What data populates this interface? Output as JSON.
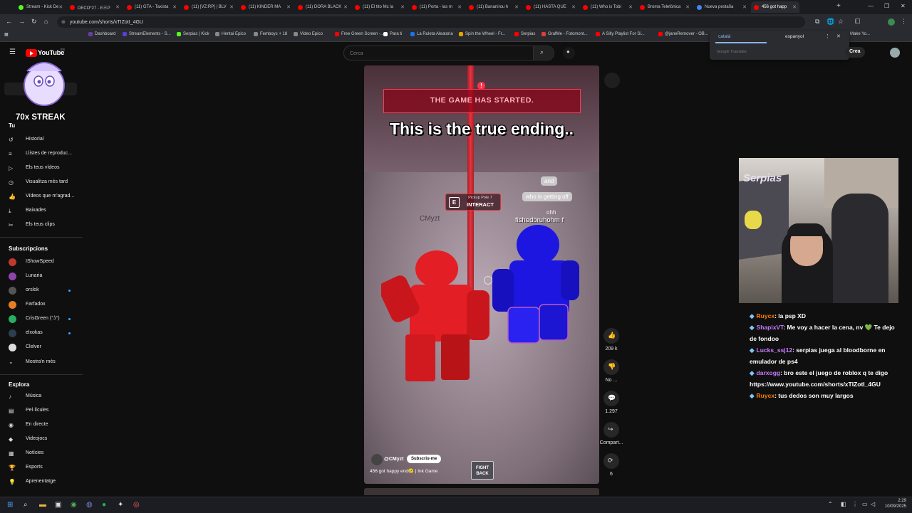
{
  "browser": {
    "tabs": [
      {
        "label": "Stream - Kick De",
        "color": "#53fc18"
      },
      {
        "label": "DECO*27 - E三P",
        "color": "#ff0000"
      },
      {
        "label": "(11) GTA - Taxista",
        "color": "#ff0000"
      },
      {
        "label": "(11) [VZ:RP] | BLV",
        "color": "#ff0000"
      },
      {
        "label": "(11) KINDER MA",
        "color": "#ff0000"
      },
      {
        "label": "(11) DORA BLACK",
        "color": "#ff0000"
      },
      {
        "label": "(11) El tito Mc la",
        "color": "#ff0000"
      },
      {
        "label": "(11) Porta - las m",
        "color": "#ff0000"
      },
      {
        "label": "(11) Bananirou h",
        "color": "#ff0000"
      },
      {
        "label": "(11) HASTA QUE",
        "color": "#ff0000"
      },
      {
        "label": "(11) Who is Tobi",
        "color": "#ff0000"
      },
      {
        "label": "Broma Telefónica",
        "color": "#ff0000"
      },
      {
        "label": "Nueva pestaña",
        "color": "#4285f4"
      },
      {
        "label": "456 got happ",
        "color": "#ff0000"
      }
    ],
    "url": "youtube.com/shorts/xTIZotI_4GU",
    "bookmarks": [
      {
        "label": "Dashboard",
        "color": "#6441a5"
      },
      {
        "label": "StreamElements - S...",
        "color": "#5a3fd6"
      },
      {
        "label": "Serpias | Kick",
        "color": "#53fc18"
      },
      {
        "label": "Hentai Epico",
        "color": "#888888"
      },
      {
        "label": "Femboys + 18",
        "color": "#888888"
      },
      {
        "label": "Video Epico",
        "color": "#888888"
      },
      {
        "label": "Free Green Screen -...",
        "color": "#ff0000"
      },
      {
        "label": "Para ti",
        "color": "#ffffff"
      },
      {
        "label": "La Ruleta Aleatoria",
        "color": "#1a73e8"
      },
      {
        "label": "Spin the Wheel - Fr...",
        "color": "#e6a400"
      },
      {
        "label": "Serpias",
        "color": "#ff0000"
      },
      {
        "label": "GrafMe - Fotomont...",
        "color": "#e33b3b"
      },
      {
        "label": "A Silly Playlist For Si...",
        "color": "#ff0000"
      },
      {
        "label": "@janeRemover - OB...",
        "color": "#ff0000"
      },
      {
        "label": "Make Yo...",
        "color": "#888888"
      }
    ],
    "translate": {
      "lang_from": "català",
      "lang_to": "espanyol",
      "label": "Google Translate"
    }
  },
  "youtube": {
    "logo": "YouTube",
    "logo_sup": "ES",
    "search_placeholder": "Cerca",
    "create_label": "Crea",
    "streak_text": "70x STREAK",
    "you_label": "Tu",
    "you_items": [
      "Historial",
      "Llistes de reproduc...",
      "Els teus vídeos",
      "Visualitza més tard",
      "Vídeos que m'agrad...",
      "Baixades",
      "Els teus clips"
    ],
    "subs_heading": "Subscripcions",
    "subscriptions": [
      {
        "name": "IShowSpeed",
        "color": "#c0392b",
        "dot": false
      },
      {
        "name": "Lunaria",
        "color": "#8e44ad",
        "dot": false
      },
      {
        "name": "orslok",
        "color": "#555555",
        "dot": true
      },
      {
        "name": "Farfadox",
        "color": "#e67e22",
        "dot": false
      },
      {
        "name": "CrisGreen (°ʖ°)",
        "color": "#27ae60",
        "dot": true
      },
      {
        "name": "elxokas",
        "color": "#2c3e50",
        "dot": true
      },
      {
        "name": "Clelver",
        "color": "#dddddd",
        "dot": false
      }
    ],
    "show_more": "Mostra'n més",
    "explore_heading": "Explora",
    "explore_items": [
      "Música",
      "Pel·lícules",
      "En directe",
      "Videojocs",
      "Notícies",
      "Esports",
      "Aprenentatge"
    ],
    "short": {
      "banner": "THE GAME HAS STARTED.",
      "caption": "This is the true ending..",
      "interact_key": "E",
      "interact_hint": "Pickup Pole 7",
      "interact_label": "INTERACT",
      "chat_bubbles": [
        "and",
        "who is getting off",
        "ohh"
      ],
      "player_left": "CMyzt",
      "player_right": "fishedbruhohm f",
      "fight_back": "FIGHT BACK",
      "channel": "@CMyzt",
      "subscribe": "Subscriu-me",
      "title": "456 got happy end😢 | Ink Game"
    },
    "actions": [
      {
        "label": "209 k",
        "icon": "like-icon"
      },
      {
        "label": "No ...",
        "icon": "dislike-icon"
      },
      {
        "label": "1.297",
        "icon": "comment-icon"
      },
      {
        "label": "Compart...",
        "icon": "share-icon"
      },
      {
        "label": "6",
        "icon": "remix-icon"
      }
    ]
  },
  "stream_overlay": {
    "cam_sign": "Serpias",
    "chat": [
      {
        "user": "Ruycx",
        "color": "#ff7f00",
        "message": ": la psp XD"
      },
      {
        "user": "ShapixVT",
        "color": "#c77dff",
        "message": ": Me voy a hacer la cena, nv 💚 Te dejo de fondoo"
      },
      {
        "user": "Lucks_ssj12",
        "color": "#c77dff",
        "message": ": serpias juega al bloodborne en emulador de ps4"
      },
      {
        "user": "darxogg",
        "color": "#c77dff",
        "message": ": bro este el juego de roblox q te digo https://www.youtube.com/shorts/xTIZotI_4GU"
      },
      {
        "user": "Ruycx",
        "color": "#ff7f00",
        "message": ": tus dedos son muy largos"
      }
    ]
  },
  "taskbar": {
    "time": "2:29",
    "date": "10/09/2025"
  }
}
